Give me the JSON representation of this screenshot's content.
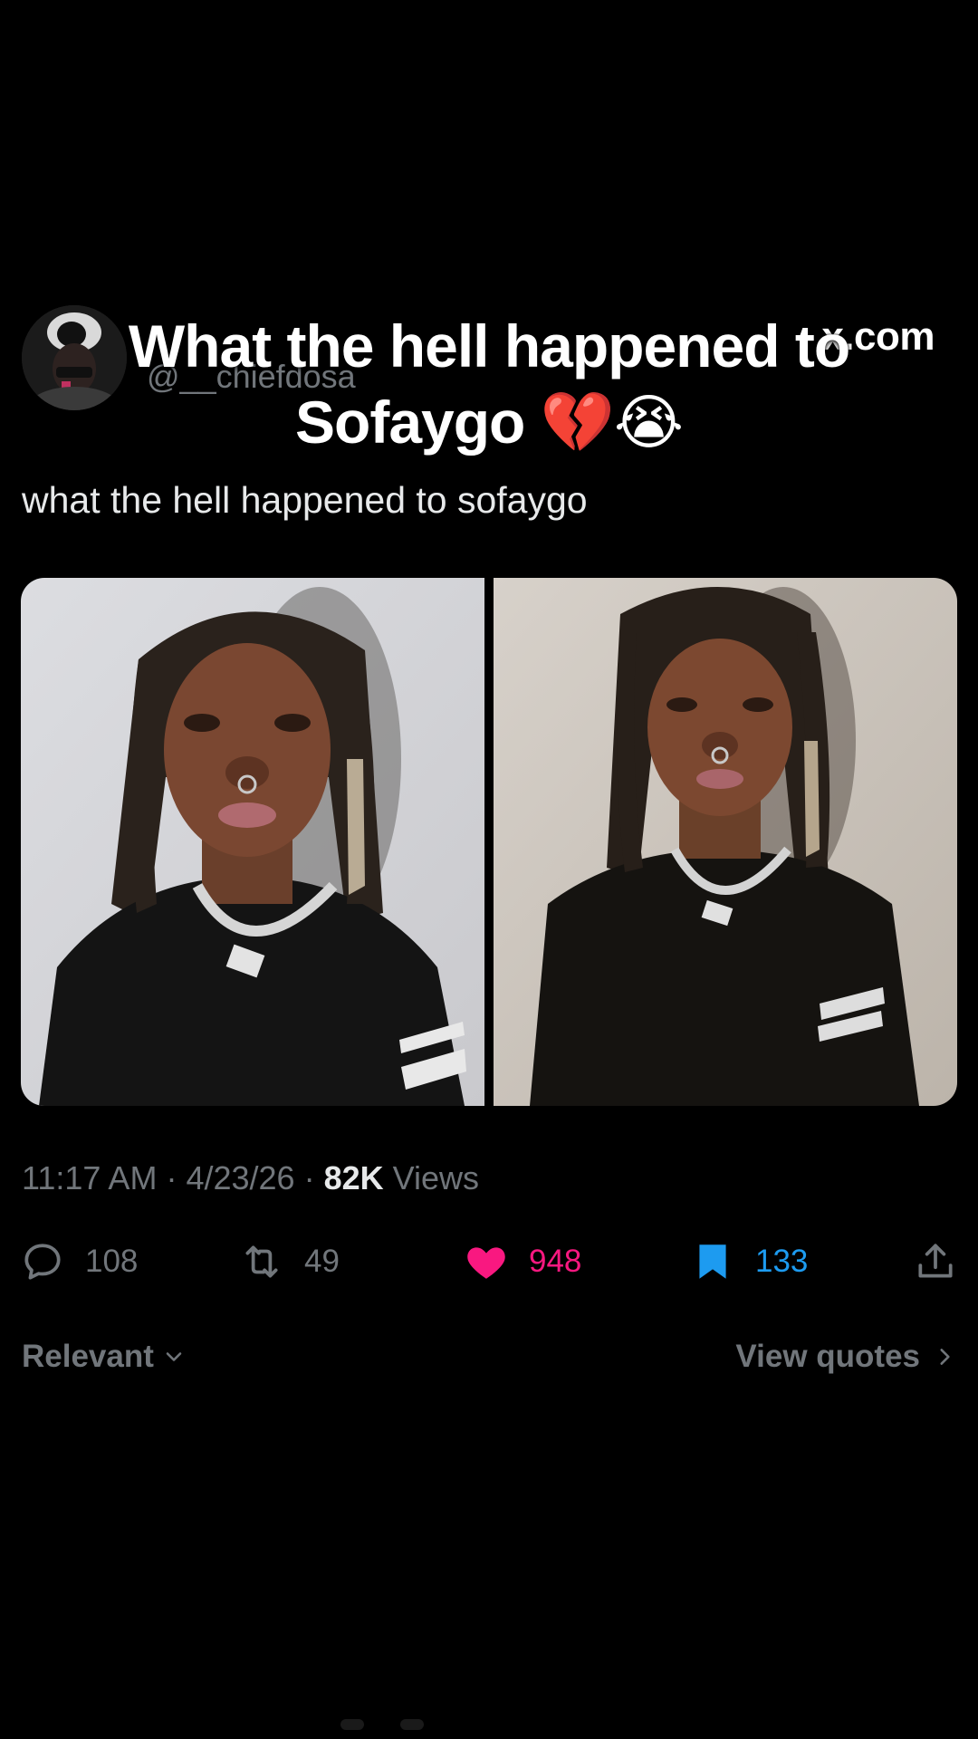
{
  "author": {
    "handle": "@__chiefdosa",
    "watermark": "x.com",
    "avatar_icon": "avatar-photo"
  },
  "overlay": {
    "caption": "What the hell happened to Sofaygo 💔😭"
  },
  "tweet": {
    "text": "what the hell happened to sofaygo",
    "media_count": 2
  },
  "meta": {
    "time": "11:17 AM",
    "date": "4/23/26",
    "views_count": "82K",
    "views_label": "Views"
  },
  "actions": {
    "replies": "108",
    "reposts": "49",
    "likes": "948",
    "bookmarks": "133",
    "colors": {
      "muted": "#71767b",
      "like": "#f91880",
      "bookmark": "#1d9bf0"
    }
  },
  "footer": {
    "sort_label": "Relevant",
    "view_quotes_label": "View quotes"
  }
}
